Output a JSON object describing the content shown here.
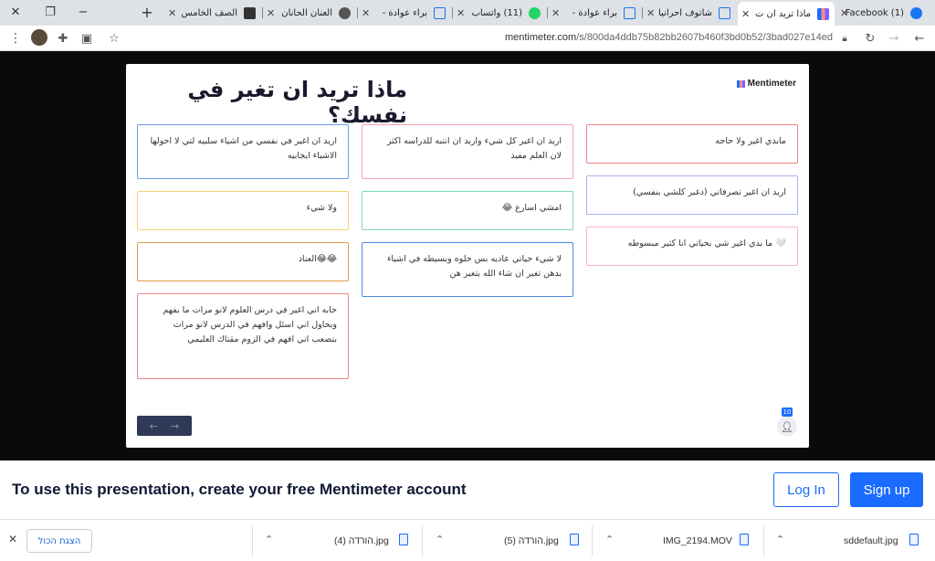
{
  "browser": {
    "tabs": [
      {
        "label": "(1) Facebook",
        "icon_color": "#1877f2",
        "icon": "facebook-icon"
      },
      {
        "label": "ماذا تريد ان ت",
        "icon_color": "#196cff",
        "icon": "mentimeter-icon",
        "active": true
      },
      {
        "label": "شاتوف احرانيا",
        "icon_color": "#1a73e8",
        "icon": "document-icon"
      },
      {
        "label": "براء عوادة -",
        "icon_color": "#1a73e8",
        "icon": "document-icon"
      },
      {
        "label": "(11) واتساب",
        "icon_color": "#25d366",
        "icon": "whatsapp-icon"
      },
      {
        "label": "براء عوادة -",
        "icon_color": "#1a73e8",
        "icon": "document-icon"
      },
      {
        "label": "العنان الحانان",
        "icon_color": "#444444",
        "icon": "globe-icon"
      },
      {
        "label": "الصف الخامس",
        "icon_color": "#333333",
        "icon": "contact-card-icon"
      }
    ],
    "url_domain": "mentimeter.com",
    "url_path": "/s/800da4ddb75b82bb2607b460f3bd0b52/3bad027e14ed"
  },
  "slide": {
    "title": "ماذا تريد ان تغير في نفسك؟",
    "brand": "Mentimeter",
    "responses": [
      {
        "text": "مابدي اغير ولا حاجه",
        "border": "#f08080"
      },
      {
        "text": "اريد ان اغير كل شيء واريد ان انتبه للدراسه اكثر لان العلم مفيد",
        "border": "#f4a3ae"
      },
      {
        "text": "اريد ان اغير في نفسي من اشياء سلبيه لتي لا احولها الاشياء ايجابيه",
        "border": "#6b9bf5"
      },
      {
        "text": "اريد ان اغير تصرفاتي (دغير كلشي بنفسي)",
        "border": "#a8b3f0"
      },
      {
        "text": "امشي اسارع 😂",
        "border": "#7dd9b6"
      },
      {
        "text": "ولا شيء",
        "border": "#f6d36b"
      },
      {
        "text": "🤍 ما بدي اغير شي بحياتي انا كثير مبسوطه",
        "border": "#f4b4c4"
      },
      {
        "text": "لا شيء حياتي عاديه بس حلوه وبسيطه في اشياء بدهن تغير ان شاء الله بتغير هن",
        "border": "#4f86e6"
      },
      {
        "text": "😂😂العناد",
        "border": "#e39a4a"
      },
      {
        "text": "حابه اني اغير في درس العلوم لانو مرات ما بفهم وبحاول اني اسئل وافهم في الدرس لانو مرات بتصعب اني افهم في الزوم مقتاك العليمي",
        "border": "#f08080"
      }
    ],
    "participant_count": "10"
  },
  "banner": {
    "message": "To use this presentation, create your free Mentimeter account",
    "login_label": "Log In",
    "signup_label": "Sign up"
  },
  "downloads": {
    "items": [
      "sddefault.jpg",
      "IMG_2194.MOV",
      "הורדה (5).jpg",
      "הורדה (4).jpg"
    ],
    "show_all_label": "הצגת הכול"
  }
}
